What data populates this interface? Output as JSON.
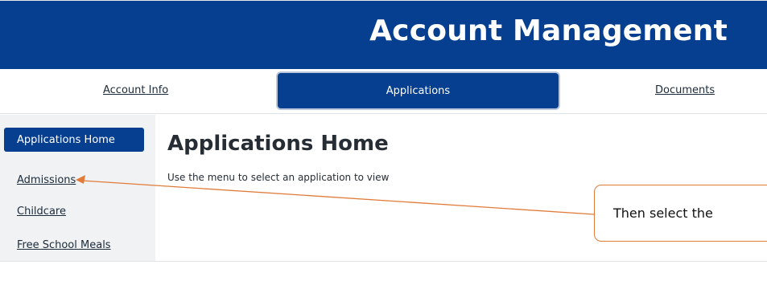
{
  "header": {
    "title": "Account Management"
  },
  "tabs": [
    {
      "label": "Account Info"
    },
    {
      "label": "Applications"
    },
    {
      "label": "Documents"
    }
  ],
  "sidebar": {
    "items": [
      {
        "label": "Applications Home"
      },
      {
        "label": "Admissions"
      },
      {
        "label": "Childcare"
      },
      {
        "label": "Free School Meals"
      }
    ]
  },
  "main": {
    "title": "Applications Home",
    "subtitle": "Use the menu to select an application to view"
  },
  "annotation": {
    "text": "Then select the",
    "color": "#e07b39"
  },
  "colors": {
    "brand": "#063f8f"
  }
}
